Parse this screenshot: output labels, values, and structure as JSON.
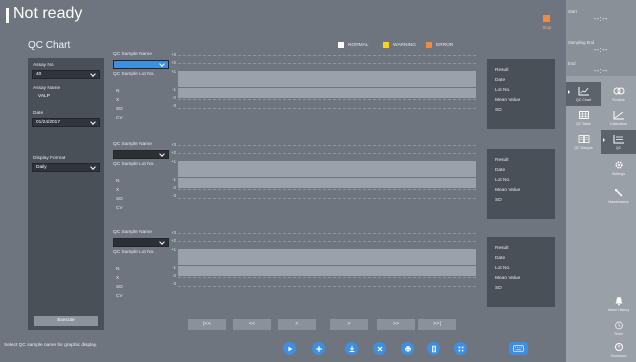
{
  "header": {
    "title": "Not ready",
    "stop_label": "Stop"
  },
  "screen_title": "QC Chart",
  "legend": [
    {
      "label": "NORMAL",
      "color": "#ffffff"
    },
    {
      "label": "WARNING",
      "color": "#f5d51a"
    },
    {
      "label": "ERROR",
      "color": "#f08a3c"
    }
  ],
  "left_panel": {
    "assay_no_label": "Assay No",
    "assay_no_value": "40",
    "assay_name_label": "Assay Name",
    "assay_name_value": "VALP",
    "date_label": "Date",
    "date_value": "01/24/2017",
    "display_format_label": "Display Format",
    "display_format_value": "Daily",
    "execute_label": "Execute"
  },
  "chart_block": {
    "sample_name_label": "QC Sample Name",
    "sample_lot_label": "QC Sample Lot No.",
    "n_label": "N",
    "x_label": "X",
    "sd_label": "SD",
    "cv_label": "CV",
    "axis": [
      "+3",
      "+2",
      "+1",
      "-1",
      "-2",
      "-3"
    ],
    "result_label": "Result",
    "date_label": "Date",
    "lot_label": "Lot No.",
    "mean_label": "Mean Value",
    "sd_result_label": "SD"
  },
  "nav_buttons": [
    "|<<",
    "<<",
    "<",
    ">",
    ">>",
    ">>|"
  ],
  "status_message": "Select QC sample name for graphic display.",
  "sidebar": {
    "start_label": "Start",
    "start_time": "--:--",
    "sampling_end_label": "Sampling End",
    "sampling_end_time": "--:--",
    "end_label": "End",
    "end_time": "--:--",
    "items": [
      {
        "label": "QC Chart",
        "icon": "chart-icon"
      },
      {
        "label": "Routine",
        "icon": "routine-icon"
      },
      {
        "label": "QC Table",
        "icon": "table-icon"
      },
      {
        "label": "Calibration",
        "icon": "calibration-icon"
      },
      {
        "label": "QC Sample",
        "icon": "sample-icon"
      },
      {
        "label": "QC",
        "icon": "qc-icon"
      },
      {
        "label": "Settings",
        "icon": "gear-icon"
      },
      {
        "label": "Maintenance",
        "icon": "wrench-icon"
      },
      {
        "label": "Alarm History",
        "icon": "bell-icon"
      },
      {
        "label": "Timer",
        "icon": "timer-icon"
      },
      {
        "label": "Shutdown",
        "icon": "power-icon"
      }
    ]
  }
}
